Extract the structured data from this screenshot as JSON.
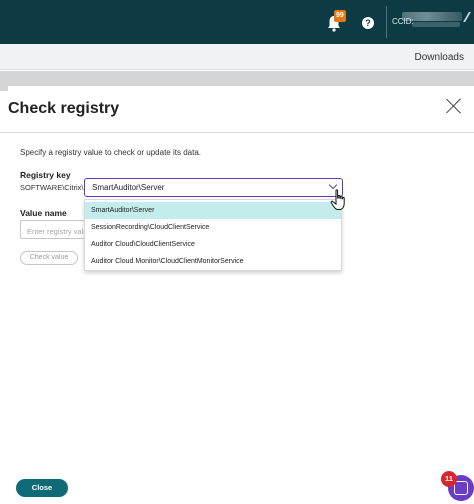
{
  "topbar": {
    "bell_badge": "99",
    "help_glyph": "?",
    "ccid_label": "CCID:",
    "bell_icon": "bell-icon",
    "help_icon": "help-icon"
  },
  "subbar": {
    "downloads": "Downloads"
  },
  "panel": {
    "title": "Check registry",
    "description": "Specify a registry value to check or update its data.",
    "registry_key_label": "Registry key",
    "registry_prefix": "SOFTWARE\\Citrix\\",
    "registry_selected": "SmartAuditor\\Server",
    "value_name_label": "Value name",
    "value_name_placeholder": "Enter registry value name",
    "check_button": "Check value",
    "options": [
      "SmartAuditor\\Server",
      "SessionRecording\\CloudClientService",
      "Auditor Cloud\\CloudClientService",
      "Auditor Cloud Monitor\\CloudClientMonitorService"
    ]
  },
  "footer": {
    "close_button": "Close"
  },
  "fab": {
    "badge": "11"
  },
  "colors": {
    "topbar": "#0c3b45",
    "accent_purple": "#6a35b8",
    "selected_option": "#c5ecec",
    "primary_button": "#0e6a75",
    "badge_red": "#d9262d",
    "bell_badge": "#e07a16"
  }
}
